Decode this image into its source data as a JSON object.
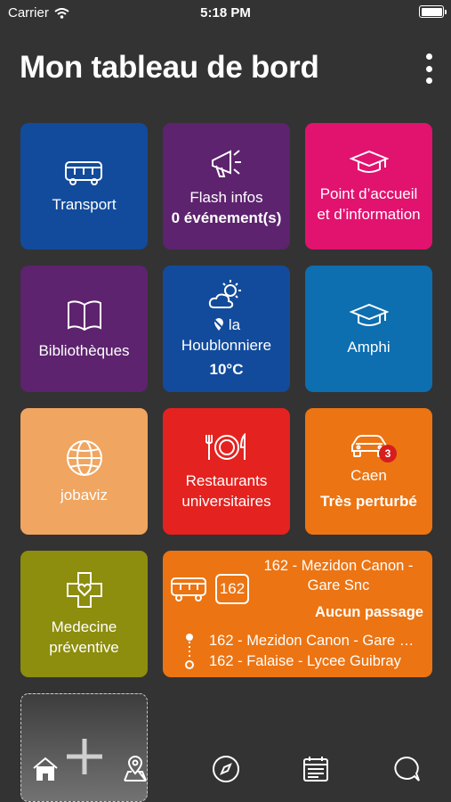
{
  "status_bar": {
    "carrier": "Carrier",
    "time": "5:18 PM"
  },
  "header": {
    "title": "Mon tableau de bord"
  },
  "tiles": {
    "transport": {
      "label": "Transport",
      "color": "#124b9c"
    },
    "flash": {
      "label": "Flash infos",
      "sub": "0 événement(s)",
      "color": "#5d236e"
    },
    "accueil": {
      "line1": "Point d’accueil",
      "line2": "et d’information",
      "color": "#e2126f"
    },
    "biblio": {
      "label": "Bibliothèques",
      "color": "#5d236e"
    },
    "weather": {
      "place_prefix": "la",
      "place": "Houblonniere",
      "temp": "10°C",
      "color": "#124b9c"
    },
    "amphi": {
      "label": "Amphi",
      "color": "#0d6eb0"
    },
    "jobaviz": {
      "label": "jobaviz",
      "color": "#f0a560"
    },
    "restaurants": {
      "line1": "Restaurants",
      "line2": "universitaires",
      "color": "#e4221f"
    },
    "traffic": {
      "city": "Caen",
      "status": "Très perturbé",
      "badge": "3",
      "color": "#ec7412"
    },
    "medecine": {
      "line1": "Medecine",
      "line2": "préventive",
      "color": "#8d8d0e"
    },
    "bus": {
      "line_number": "162",
      "destination_line1": "162 - Mezidon Canon -",
      "destination_line2": "Gare Snc",
      "status": "Aucun passage",
      "stop_from": "162 - Mezidon Canon - Gare …",
      "stop_to": "162 - Falaise - Lycee Guibray",
      "color": "#ec7412"
    }
  },
  "tabbar": [
    "home-icon",
    "map-pin-icon",
    "compass-icon",
    "calendar-icon",
    "chat-icon"
  ]
}
